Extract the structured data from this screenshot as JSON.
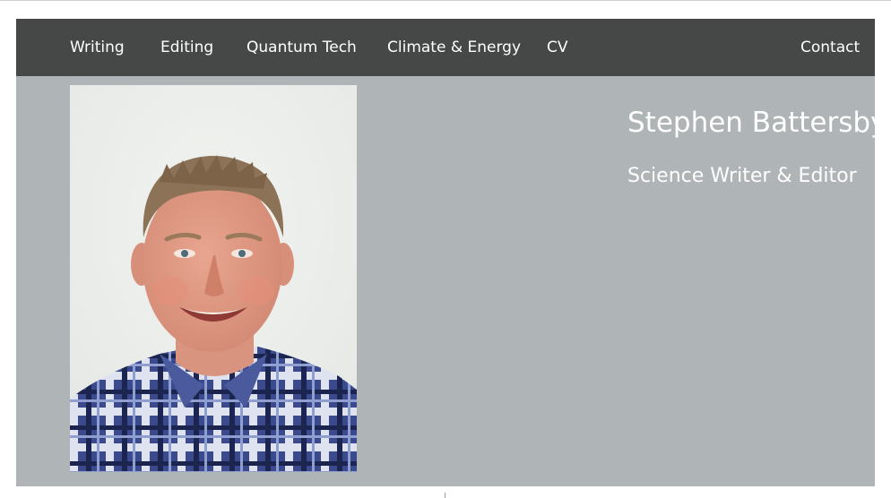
{
  "nav": {
    "items": [
      {
        "label": "Writing"
      },
      {
        "label": "Editing"
      },
      {
        "label": "Quantum Tech"
      },
      {
        "label": "Climate & Energy"
      },
      {
        "label": "CV"
      }
    ],
    "contact": "Contact"
  },
  "hero": {
    "name": "Stephen Battersby",
    "role": "Science Writer & Editor"
  },
  "colors": {
    "navbar": "#464747",
    "hero_background": "#afb4b6",
    "text": "#ffffff"
  }
}
